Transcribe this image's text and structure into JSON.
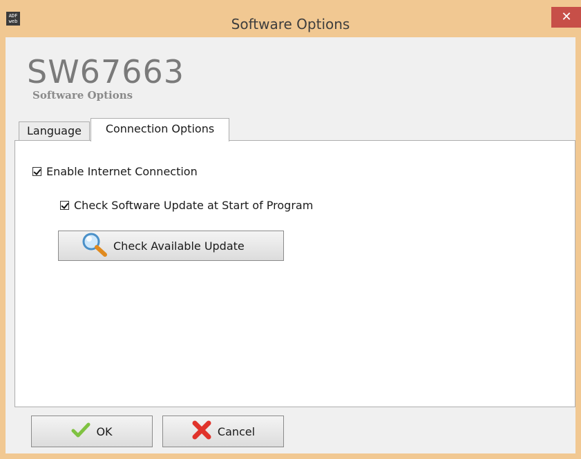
{
  "window": {
    "title": "Software Options",
    "app_icon_text": "ADF\nweb",
    "close_glyph": "✕"
  },
  "header": {
    "product_code": "SW67663",
    "subtitle": "Software Options"
  },
  "tabs": [
    {
      "label": "Language",
      "active": false
    },
    {
      "label": "Connection Options",
      "active": true
    }
  ],
  "connection": {
    "enable_internet_label": "Enable Internet Connection",
    "enable_internet_checked": true,
    "check_update_label": "Check Software Update at Start of Program",
    "check_update_checked": true,
    "check_available_button": "Check Available Update"
  },
  "footer": {
    "ok_label": "OK",
    "cancel_label": "Cancel"
  },
  "colors": {
    "titlebar": "#f1c892",
    "close_button": "#c74f48",
    "ok_check": "#7fc241",
    "cancel_x": "#e0332b"
  },
  "icons": [
    "app-icon",
    "close-icon",
    "magnifier-icon",
    "checkmark-icon",
    "cross-icon"
  ]
}
